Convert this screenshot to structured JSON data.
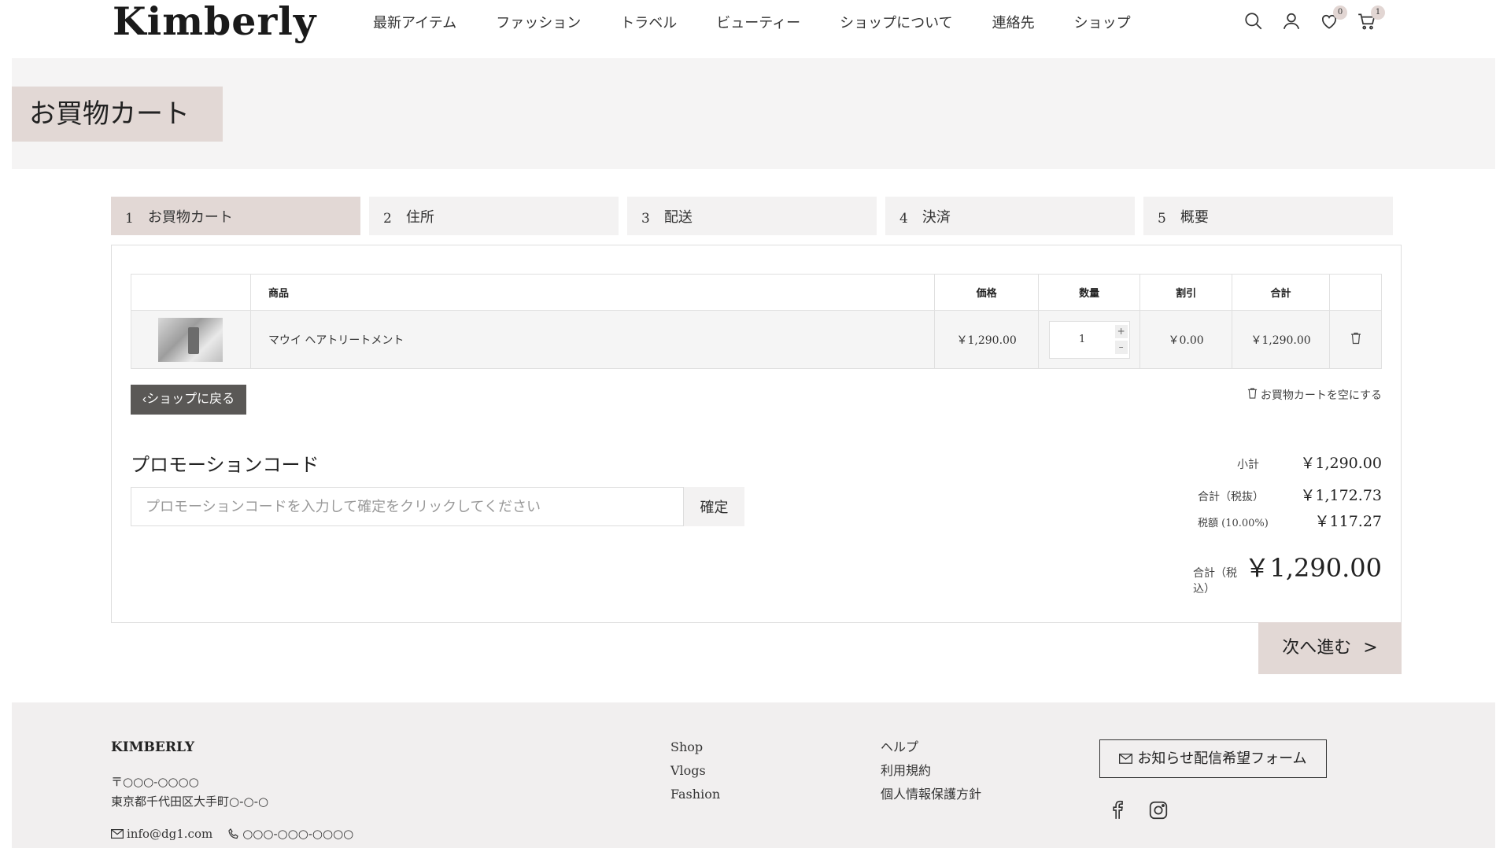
{
  "brand": {
    "logo": "Kimberly"
  },
  "nav": [
    "最新アイテム",
    "ファッション",
    "トラベル",
    "ビューティー",
    "ショップについて",
    "連絡先",
    "ショップ"
  ],
  "header_icons": {
    "wishlist_count": "0",
    "cart_count": "1"
  },
  "hero": {
    "title": "お買物カート"
  },
  "steps": [
    {
      "num": "1",
      "label": "お買物カート"
    },
    {
      "num": "2",
      "label": "住所"
    },
    {
      "num": "3",
      "label": "配送"
    },
    {
      "num": "4",
      "label": "決済"
    },
    {
      "num": "5",
      "label": "概要"
    }
  ],
  "table": {
    "headers": {
      "product": "商品",
      "price": "価格",
      "qty": "数量",
      "discount": "割引",
      "total": "合計"
    },
    "row": {
      "name": "マウイ ヘアトリートメント",
      "price": "￥1,290.00",
      "qty": "1",
      "discount": "￥0.00",
      "total": "￥1,290.00"
    }
  },
  "actions": {
    "back": "ショップに戻る",
    "empty": "お買物カートを空にする"
  },
  "promo": {
    "title": "プロモーションコード",
    "placeholder": "プロモーションコードを入力して確定をクリックしてください",
    "button": "確定"
  },
  "totals": {
    "subtotal_label": "小計",
    "subtotal": "￥1,290.00",
    "excl_label": "合計（税抜）",
    "excl": "￥1,172.73",
    "tax_label": "税額 (10.00%)",
    "tax": "￥117.27",
    "grand_label": "合計（税込）",
    "grand": "￥1,290.00"
  },
  "next": "次へ進む",
  "footer": {
    "brand": "KIMBERLY",
    "zip": "〒○○○-○○○○",
    "address": "東京都千代田区大手町○-○-○",
    "email": "info@dg1.com",
    "phone": "○○○-○○○-○○○○",
    "links1": [
      "Shop",
      "Vlogs",
      "Fashion"
    ],
    "links2": [
      "ヘルプ",
      "利用規約",
      "個人情報保護方針"
    ],
    "newsletter": "お知らせ配信希望フォーム"
  }
}
